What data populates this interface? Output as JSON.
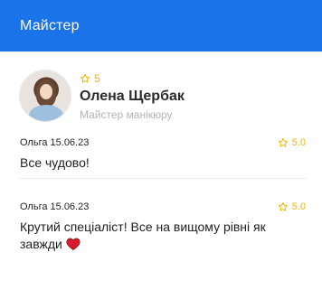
{
  "header": {
    "title": "Майстер"
  },
  "master": {
    "rating": "5",
    "name": "Олена Щербак",
    "role": "Майстер манікюру"
  },
  "reviews": [
    {
      "author_date": "Ольга 15.06.23",
      "rating": "5.0",
      "text": "Все чудово!"
    },
    {
      "author_date": "Ольга 15.06.23",
      "rating": "5.0",
      "text": "Крутий спеціаліст! Все на вищому рівні як завжди"
    }
  ],
  "colors": {
    "accent": "#1a73e8",
    "star": "#f2b705",
    "heart": "#d81b2c"
  }
}
